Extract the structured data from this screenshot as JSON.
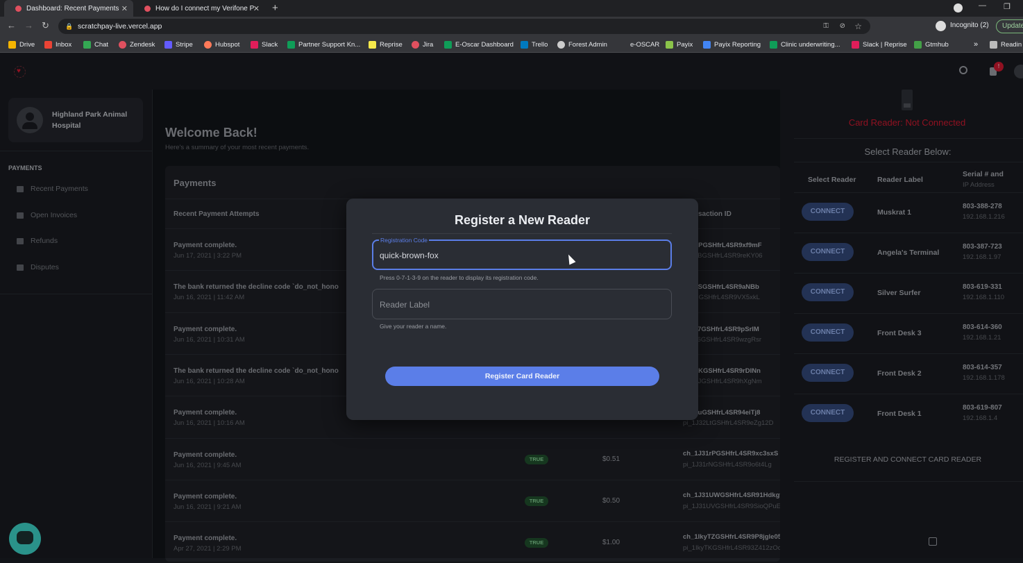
{
  "browser": {
    "tabs": [
      {
        "title": "Dashboard: Recent Payments",
        "active": true
      },
      {
        "title": "How do I connect my Verifone P",
        "active": false
      }
    ],
    "url": "scratchpay-live.vercel.app",
    "profile": "Incognito (2)",
    "update_label": "Update",
    "bookmarks": [
      "Drive",
      "Inbox",
      "Chat",
      "Zendesk",
      "Stripe",
      "Hubspot",
      "Slack",
      "Partner Support Kn...",
      "Reprise",
      "Jira",
      "E-Oscar Dashboard",
      "Trello",
      "Forest Admin",
      "e-OSCAR",
      "Payix",
      "Payix Reporting",
      "Clinic underwriting...",
      "Slack | Reprise",
      "Gtmhub"
    ],
    "reading_list": "Readin"
  },
  "header": {
    "notification_count": "!"
  },
  "sidebar": {
    "org_name": "Highland Park Animal Hospital",
    "section": "PAYMENTS",
    "items": [
      "Recent Payments",
      "Open Invoices",
      "Refunds",
      "Disputes"
    ]
  },
  "main": {
    "title": "Welcome Back!",
    "subtitle": "Here's a summary of your most recent payments.",
    "card_title": "Payments",
    "col_attempts": "Recent Payment Attempts",
    "col_txn": "saction ID",
    "rows": [
      {
        "title": "Payment complete.",
        "date": "Jun 17, 2021 | 3:22 PM",
        "badge": "",
        "amount": "",
        "ch": "J3TbPGSHfrL4SR9xf9mF",
        "pi": "J3TbBGSHfrL4SR9reKY06"
      },
      {
        "title": "The bank returned the decline code `do_not_hono",
        "date": "Jun 16, 2021 | 11:42 AM",
        "badge": "",
        "amount": "",
        "ch": "J33hSGSHfrL4SR9aNBb",
        "pi": "33hRGSHfrL4SR9VX5xkL"
      },
      {
        "title": "Payment complete.",
        "date": "Jun 16, 2021 | 10:31 AM",
        "badge": "",
        "amount": "",
        "ch": "J32a7GSHfrL4SR9pSrIM",
        "pi": "J32a6GSHfrL4SR9wzgRsr"
      },
      {
        "title": "The bank returned the decline code `do_not_hono",
        "date": "Jun 16, 2021 | 10:28 AM",
        "badge": "",
        "amount": "",
        "ch": "J32XKGSHfrL4SR9rDINn",
        "pi": "J32XJGSHfrL4SR9hXgNm"
      },
      {
        "title": "Payment complete.",
        "date": "Jun 16, 2021 | 10:16 AM",
        "badge": "",
        "amount": "",
        "ch": "J32LuGSHfrL4SR94eiTj8",
        "pi": "pi_1J32LtGSHfrL4SR9eZg12D"
      },
      {
        "title": "Payment complete.",
        "date": "Jun 16, 2021 | 9:45 AM",
        "badge": "TRUE",
        "amount": "$0.51",
        "ch": "ch_1J31rPGSHfrL4SR9xc3sxS",
        "pi": "pi_1J31rNGSHfrL4SR9o6t4Lg"
      },
      {
        "title": "Payment complete.",
        "date": "Jun 16, 2021 | 9:21 AM",
        "badge": "TRUE",
        "amount": "$0.50",
        "ch": "ch_1J31UWGSHfrL4SR91HdkgtdP",
        "pi": "pi_1J31UVGSHfrL4SR9SioQPuE5"
      },
      {
        "title": "Payment complete.",
        "date": "Apr 27, 2021 | 2:29 PM",
        "badge": "TRUE",
        "amount": "$1.00",
        "ch": "ch_1IkyTZGSHfrL4SR9P8jgle05",
        "pi": "pi_1IkyTKGSHfrL4SR93Z412zOo"
      }
    ]
  },
  "reader_panel": {
    "status": "Card Reader: Not Connected",
    "select_heading": "Select Reader Below:",
    "col_select": "Select Reader",
    "col_label": "Reader Label",
    "col_serial": "Serial # and",
    "col_ip": "IP Address",
    "connect_label": "CONNECT",
    "readers": [
      {
        "label": "Muskrat 1",
        "serial": "803-388-278",
        "ip": "192.168.1.216"
      },
      {
        "label": "Angela's Terminal",
        "serial": "803-387-723",
        "ip": "192.168.1.97"
      },
      {
        "label": "Silver Surfer",
        "serial": "803-619-331",
        "ip": "192.168.1.110"
      },
      {
        "label": "Front Desk 3",
        "serial": "803-614-360",
        "ip": "192.168.1.21"
      },
      {
        "label": "Front Desk 2",
        "serial": "803-614-357",
        "ip": "192.168.1.178"
      },
      {
        "label": "Front Desk 1",
        "serial": "803-619-807",
        "ip": "192.168.1.4"
      }
    ],
    "register_connect": "REGISTER AND CONNECT CARD READER"
  },
  "modal": {
    "title": "Register a New Reader",
    "code_label": "Registration Code",
    "code_value": "quick-brown-fox",
    "code_help": "Press 0-7-1-3-9 on the reader to display its registration code.",
    "label_placeholder": "Reader Label",
    "label_help": "Give your reader a name.",
    "submit": "Register Card Reader"
  },
  "colors": {
    "accent": "#5b7ee8",
    "danger": "#c0172c",
    "success": "#7cc18a"
  }
}
